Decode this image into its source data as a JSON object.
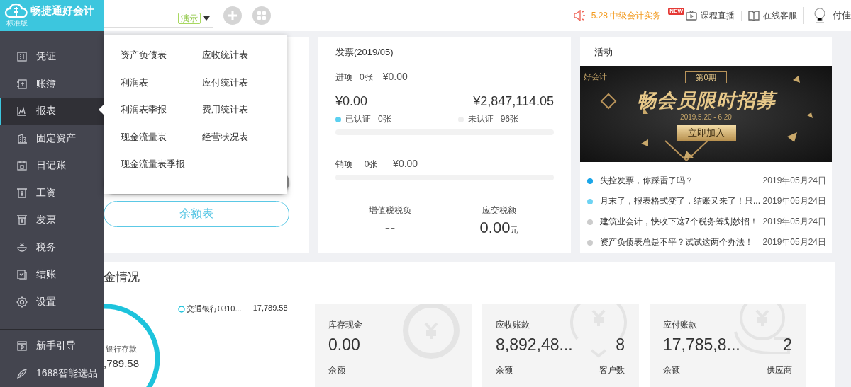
{
  "sidebar": {
    "logo": "畅捷通好会计",
    "edition": "标准版",
    "items": [
      {
        "label": "凭证",
        "kind": "voucher",
        "selected": false
      },
      {
        "label": "账簿",
        "kind": "ledger",
        "selected": false
      },
      {
        "label": "报表",
        "kind": "chart",
        "selected": true
      },
      {
        "label": "固定资产",
        "kind": "building",
        "selected": false
      },
      {
        "label": "日记账",
        "kind": "calendar",
        "selected": false
      },
      {
        "label": "工资",
        "kind": "payroll",
        "selected": false
      },
      {
        "label": "发票",
        "kind": "invoice",
        "selected": false
      },
      {
        "label": "税务",
        "kind": "tax",
        "selected": false
      },
      {
        "label": "结账",
        "kind": "closing",
        "selected": false
      },
      {
        "label": "设置",
        "kind": "settings",
        "selected": false
      }
    ],
    "footer_items": [
      {
        "label": "新手引导",
        "kind": "video"
      },
      {
        "label": "1688智能选品",
        "kind": "leaf"
      }
    ]
  },
  "topbar": {
    "demo_badge": "演示",
    "notice": "5.28 中级会计实务",
    "new_badge": "NEW",
    "links": [
      {
        "label": "课程直播",
        "kind": "tv"
      },
      {
        "label": "在线客服",
        "kind": "book"
      }
    ],
    "user": "付佳"
  },
  "report_menu": {
    "items": [
      "资产负债表",
      "应收统计表",
      "利润表",
      "应付统计表",
      "利润表季报",
      "费用统计表",
      "现金流量表",
      "经营状况表",
      "现金流量表季报"
    ]
  },
  "balance_card": {
    "button": "余额表"
  },
  "invoice": {
    "title": "发票(2019/05)",
    "input": {
      "label": "进项",
      "count": "0张",
      "amount": "¥0.00",
      "level": 0
    },
    "certified": {
      "amount": "¥0.00",
      "label": "已认证",
      "count": "0张"
    },
    "uncertified": {
      "amount": "¥2,847,114.05",
      "label": "未认证",
      "count": "96张"
    },
    "output": {
      "label": "销项",
      "count": "0张",
      "amount": "¥0.00",
      "level": 0
    },
    "stats": [
      {
        "label": "增值税税负",
        "value": "--"
      },
      {
        "label": "应交税额",
        "value": "0.00",
        "unit": "元"
      }
    ]
  },
  "activity": {
    "title": "活动",
    "banner": {
      "logo": "好会计",
      "issue": "第0期",
      "headline": "畅会员限时招募",
      "dates": "2019.5.20 - 6.20",
      "cta": "立即加入"
    },
    "news": [
      {
        "title": "失控发票，你踩雷了吗？",
        "date": "2019年05月24日",
        "color": "#1ba6e8"
      },
      {
        "title": "月末了，报表格式变了，结账又来了！只...",
        "date": "2019年05月24日",
        "color": "#6dd3f3"
      },
      {
        "title": "建筑业会计，快收下这7个税务筹划妙招！",
        "date": "2019年05月24日",
        "color": "#cccccc"
      },
      {
        "title": "资产负债表总是不平？试试这两个办法！",
        "date": "2019年05月24日",
        "color": "#cccccc"
      }
    ]
  },
  "funds": {
    "title": "金情况",
    "ring": {
      "label": "银行存款",
      "value": ",789.58"
    },
    "accounts": [
      {
        "name": "交通银行0310...",
        "amount": "17,789.58"
      }
    ],
    "cards": [
      {
        "kind": "cash",
        "title": "库存现金",
        "value": "0.00",
        "footer": "余额"
      },
      {
        "kind": "receivable",
        "title": "应收账款",
        "value": "8,892,48...",
        "count": "8",
        "footer": "余额",
        "count_label": "客户数"
      },
      {
        "kind": "payable",
        "title": "应付账款",
        "value": "17,785,8...",
        "count": "2",
        "footer": "余额",
        "count_label": "供应商"
      }
    ]
  }
}
